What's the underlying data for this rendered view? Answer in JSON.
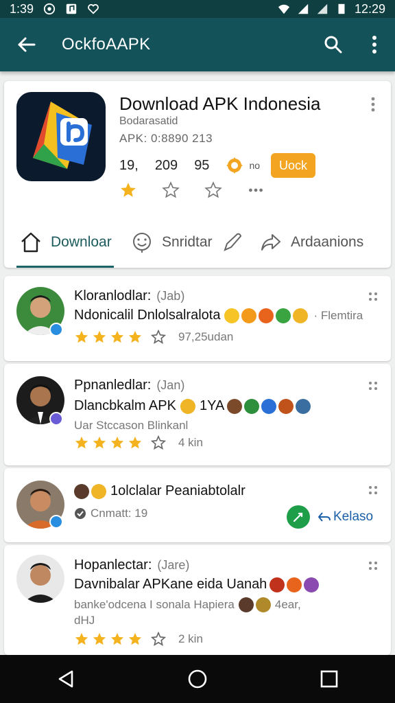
{
  "status_bar": {
    "time_left": "1:39",
    "time_right": "12:29"
  },
  "app_bar": {
    "title": "OckfoAAPK"
  },
  "app": {
    "name": "Download APK Indonesia",
    "developer": "Bodarasatid",
    "apk_info": "APK: 0:8890 213",
    "stats": [
      "19,",
      "209",
      "95"
    ],
    "badge_text": "no",
    "unlock_label": "Uock"
  },
  "tabs": [
    {
      "label": "Downloar",
      "icon": "home-icon"
    },
    {
      "label": "Snridtar",
      "icon": "smiley-icon"
    },
    {
      "label": "Ardaanions",
      "icon": "share-icon"
    }
  ],
  "reviews": [
    {
      "name": "Kloranlodlar:",
      "tag": "(Jab)",
      "text": "Ndonicalil Dnlolsalralota",
      "extra": "· Flemtira",
      "rating": 4,
      "count": "97,25udan"
    },
    {
      "name": "Ppnanledlar:",
      "tag": "(Jan)",
      "text": "Dlancbkalm APK",
      "text_suffix": "1YA",
      "meta": "Uar Stccason Blinkanl",
      "rating": 4,
      "count": "4 kin"
    },
    {
      "name": "1olclalar Peaniabtolalr",
      "meta": "Cnmatt: 19",
      "reply_label": "Kelaso"
    },
    {
      "name": "Hopanlectar:",
      "tag": "(Jare)",
      "text": "Davnibalar APKane eida Uanah",
      "meta": "banke'odcena I sonala Hapiera",
      "meta_suffix": "4ear,",
      "meta_line2": "dHJ",
      "rating": 4,
      "count": "2 kin"
    }
  ],
  "colors": {
    "accent": "#14525a",
    "star": "#f3b21e",
    "unlock": "#f3a521",
    "reply_green": "#1f9e4a"
  }
}
